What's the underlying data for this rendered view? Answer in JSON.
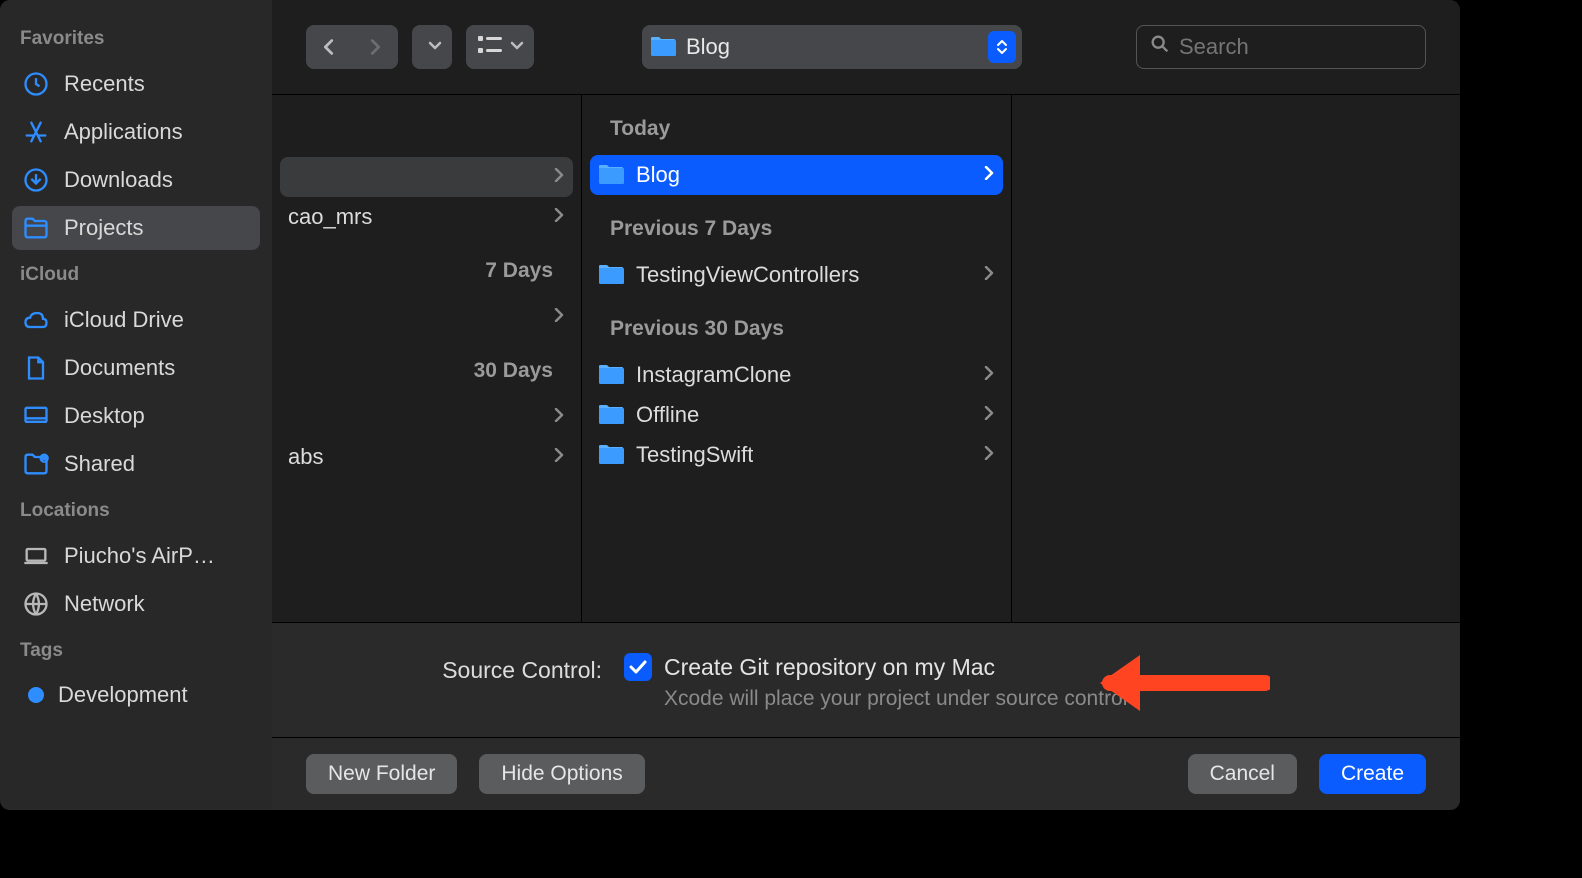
{
  "sidebar": {
    "favorites_label": "Favorites",
    "items": [
      {
        "label": "Recents"
      },
      {
        "label": "Applications"
      },
      {
        "label": "Downloads"
      },
      {
        "label": "Projects"
      }
    ],
    "icloud_label": "iCloud",
    "icloud_items": [
      {
        "label": "iCloud Drive"
      },
      {
        "label": "Documents"
      },
      {
        "label": "Desktop"
      },
      {
        "label": "Shared"
      }
    ],
    "locations_label": "Locations",
    "locations_items": [
      {
        "label": "Piucho's AirP…"
      },
      {
        "label": "Network"
      }
    ],
    "tags_label": "Tags",
    "tags_items": [
      {
        "label": "Development"
      }
    ]
  },
  "toolbar": {
    "path_label": "Blog",
    "search_placeholder": "Search"
  },
  "column0": {
    "groups": [
      {
        "rows": [
          {
            "label": ""
          }
        ]
      },
      {
        "rows": [
          {
            "label": "cao_mrs"
          }
        ]
      },
      {
        "header": "7 Days",
        "rows": [
          {
            "label": ""
          }
        ]
      },
      {
        "header": "30 Days",
        "rows": [
          {
            "label": ""
          },
          {
            "label": "abs"
          }
        ]
      }
    ]
  },
  "column1": {
    "groups": [
      {
        "header": "Today",
        "rows": [
          {
            "label": "Blog",
            "selected": true
          }
        ]
      },
      {
        "header": "Previous 7 Days",
        "rows": [
          {
            "label": "TestingViewControllers"
          }
        ]
      },
      {
        "header": "Previous 30 Days",
        "rows": [
          {
            "label": "InstagramClone"
          },
          {
            "label": "Offline"
          },
          {
            "label": "TestingSwift"
          }
        ]
      }
    ]
  },
  "source_control": {
    "label": "Source Control:",
    "checkbox_label": "Create Git repository on my Mac",
    "subtext": "Xcode will place your project under source control"
  },
  "bottom": {
    "new_folder": "New Folder",
    "hide_options": "Hide Options",
    "cancel": "Cancel",
    "create": "Create"
  }
}
